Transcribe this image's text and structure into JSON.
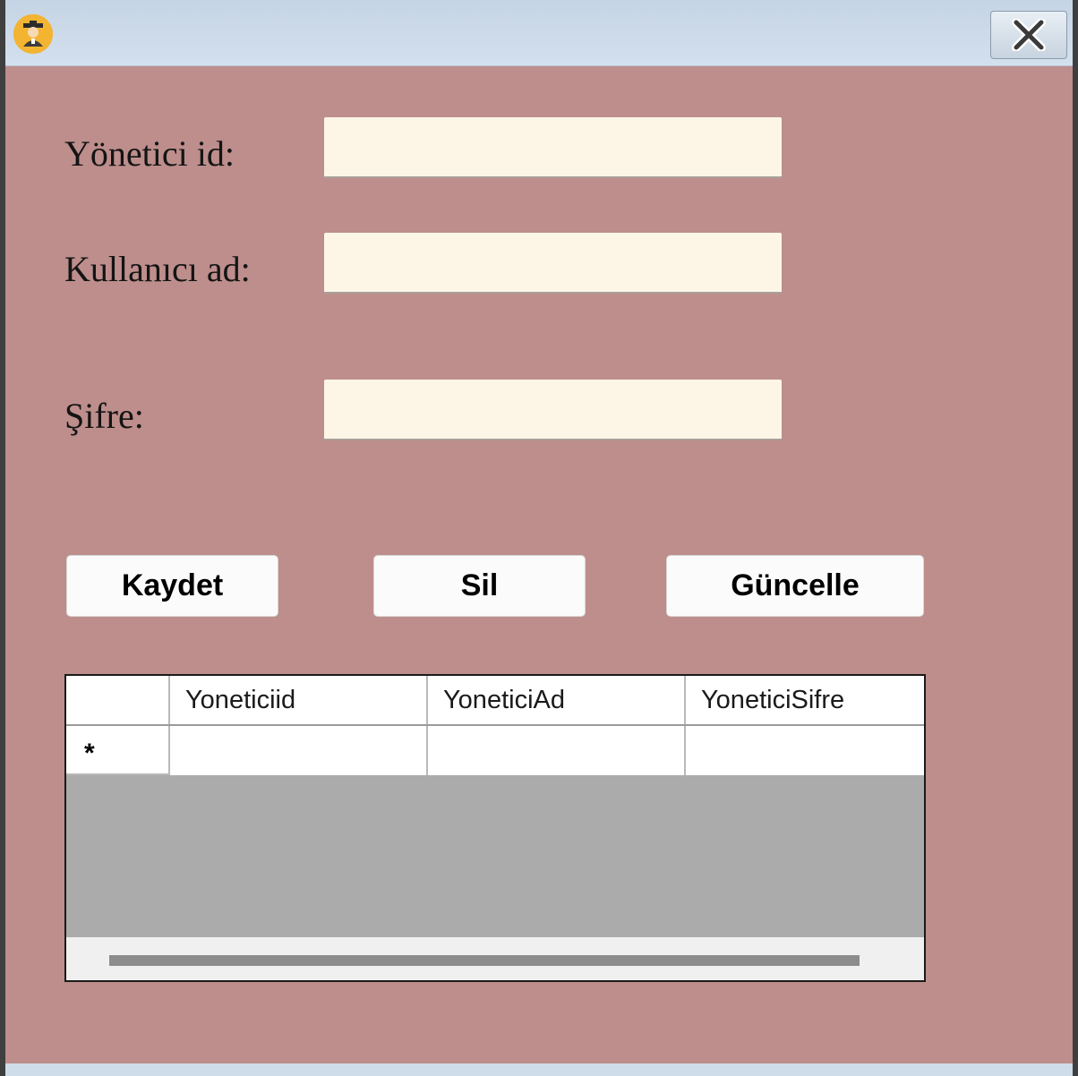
{
  "window": {
    "icon": "student-avatar-icon",
    "close_icon": "close-icon"
  },
  "form": {
    "id_label": "Yönetici id:",
    "id_value": "",
    "username_label": "Kullanıcı ad:",
    "username_value": "",
    "password_label": "Şifre:",
    "password_value": ""
  },
  "buttons": {
    "save": "Kaydet",
    "delete": "Sil",
    "update": "Güncelle"
  },
  "grid": {
    "columns": [
      "Yoneticiid",
      "YoneticiAd",
      "YoneticiSifre"
    ],
    "new_row_marker": "*",
    "rows": [
      [
        "",
        "",
        ""
      ]
    ]
  },
  "colors": {
    "form_background": "#bd8e8c",
    "textbox_background": "#fdf5e6",
    "grid_empty_area": "#ababab"
  }
}
